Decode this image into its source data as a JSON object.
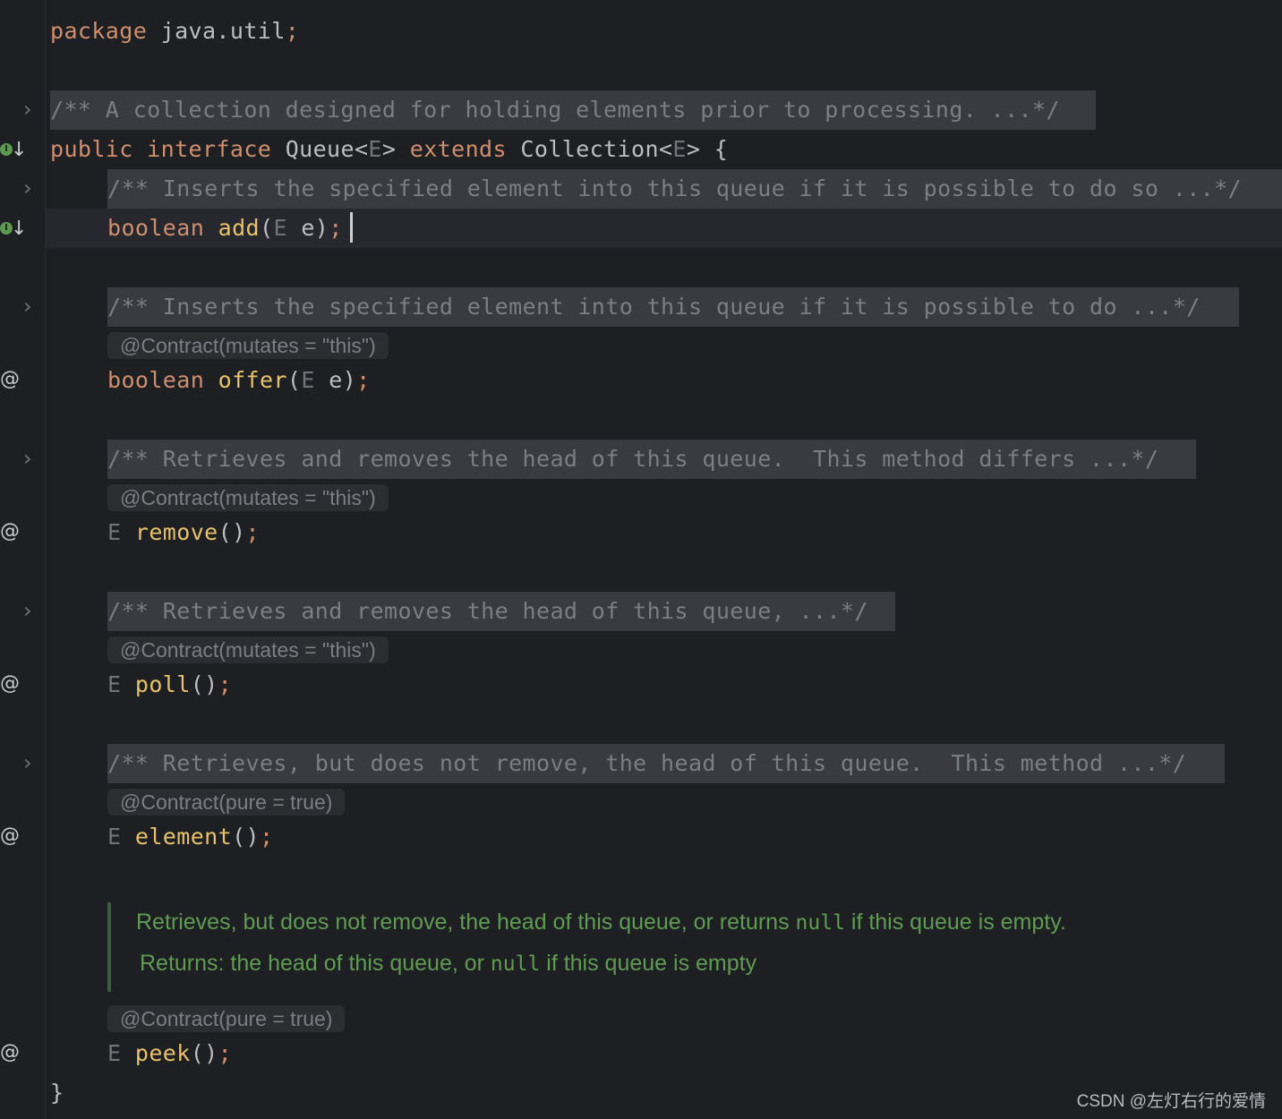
{
  "code": {
    "package_kw": "package",
    "package_name": "java.util",
    "semicolon": ";",
    "doc_collapsed_1": "/** A collection designed for holding elements prior to processing. ...*/",
    "decl_public": "public",
    "decl_interface": "interface",
    "decl_queue": "Queue<",
    "decl_E": "E",
    "decl_close": ">",
    "decl_extends": "extends",
    "decl_collection": "Collection<",
    "decl_brace": "{",
    "doc_add": "/** Inserts the specified element into this queue if it is possible to do so ...*/",
    "add_ret": "boolean",
    "add_name": "add",
    "add_params_open": "(",
    "add_param_type": "E",
    "add_param_rest": " e)",
    "doc_offer": "/** Inserts the specified element into this queue if it is possible to do ...*/",
    "contract_this": "@Contract(mutates = \"this\")",
    "offer_ret": "boolean",
    "offer_name": "offer",
    "doc_remove": "/** Retrieves and removes the head of this queue.  This method differs ...*/",
    "E": "E",
    "remove_name": "remove",
    "parens": "()",
    "doc_poll": "/** Retrieves and removes the head of this queue, ...*/",
    "poll_name": "poll",
    "doc_element": "/** Retrieves, but does not remove, the head of this queue.  This method ...*/",
    "contract_pure": "@Contract(pure = true)",
    "element_name": "element",
    "peek_doc_line1_a": "Retrieves, but does not remove, the head of this queue, or returns ",
    "null": "null",
    "peek_doc_line1_b": " if this queue is empty.",
    "peek_doc_line2_a": "Returns: the head of this queue, or ",
    "peek_doc_line2_b": " if this queue is empty",
    "peek_name": "peek",
    "close_brace": "}"
  },
  "gutter": {
    "fold_icon": "chevron-right-icon",
    "impl_icon": "implemented-down-arrow-icon",
    "at_icon": "annotation-at-icon",
    "at_glyph": "@",
    "impl_glyph": "I",
    "arrow_glyph": "↓",
    "fold_glyph": "›"
  },
  "watermark": "CSDN @左灯右行的爱情"
}
